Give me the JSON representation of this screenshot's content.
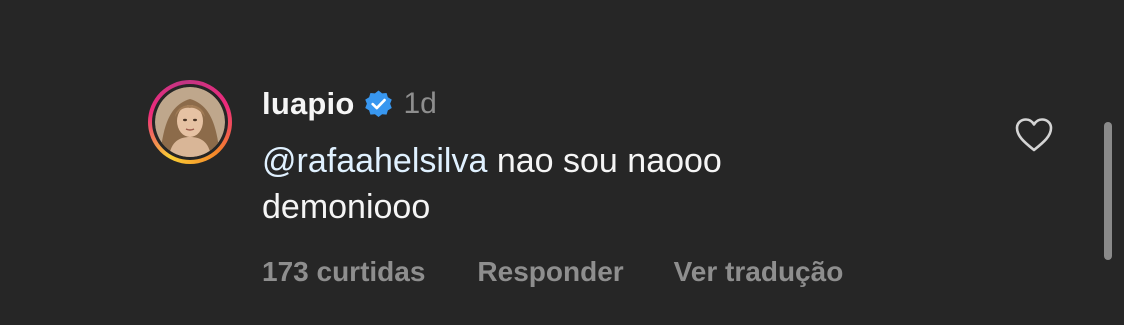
{
  "comment": {
    "username": "luapio",
    "verified": true,
    "time": "1d",
    "mention": "@rafaahelsilva",
    "text_line1": " nao sou naooo",
    "text_line2": "demoniooo",
    "likes": "173 curtidas",
    "reply_label": "Responder",
    "translate_label": "Ver tradução"
  },
  "icons": {
    "verified": "verified-badge-icon",
    "like": "heart-outline-icon"
  },
  "colors": {
    "background": "#262626",
    "primary_text": "#f5f5f5",
    "secondary_text": "#8e8e8e",
    "mention": "#e0f1ff",
    "verified_blue": "#3897f0"
  }
}
